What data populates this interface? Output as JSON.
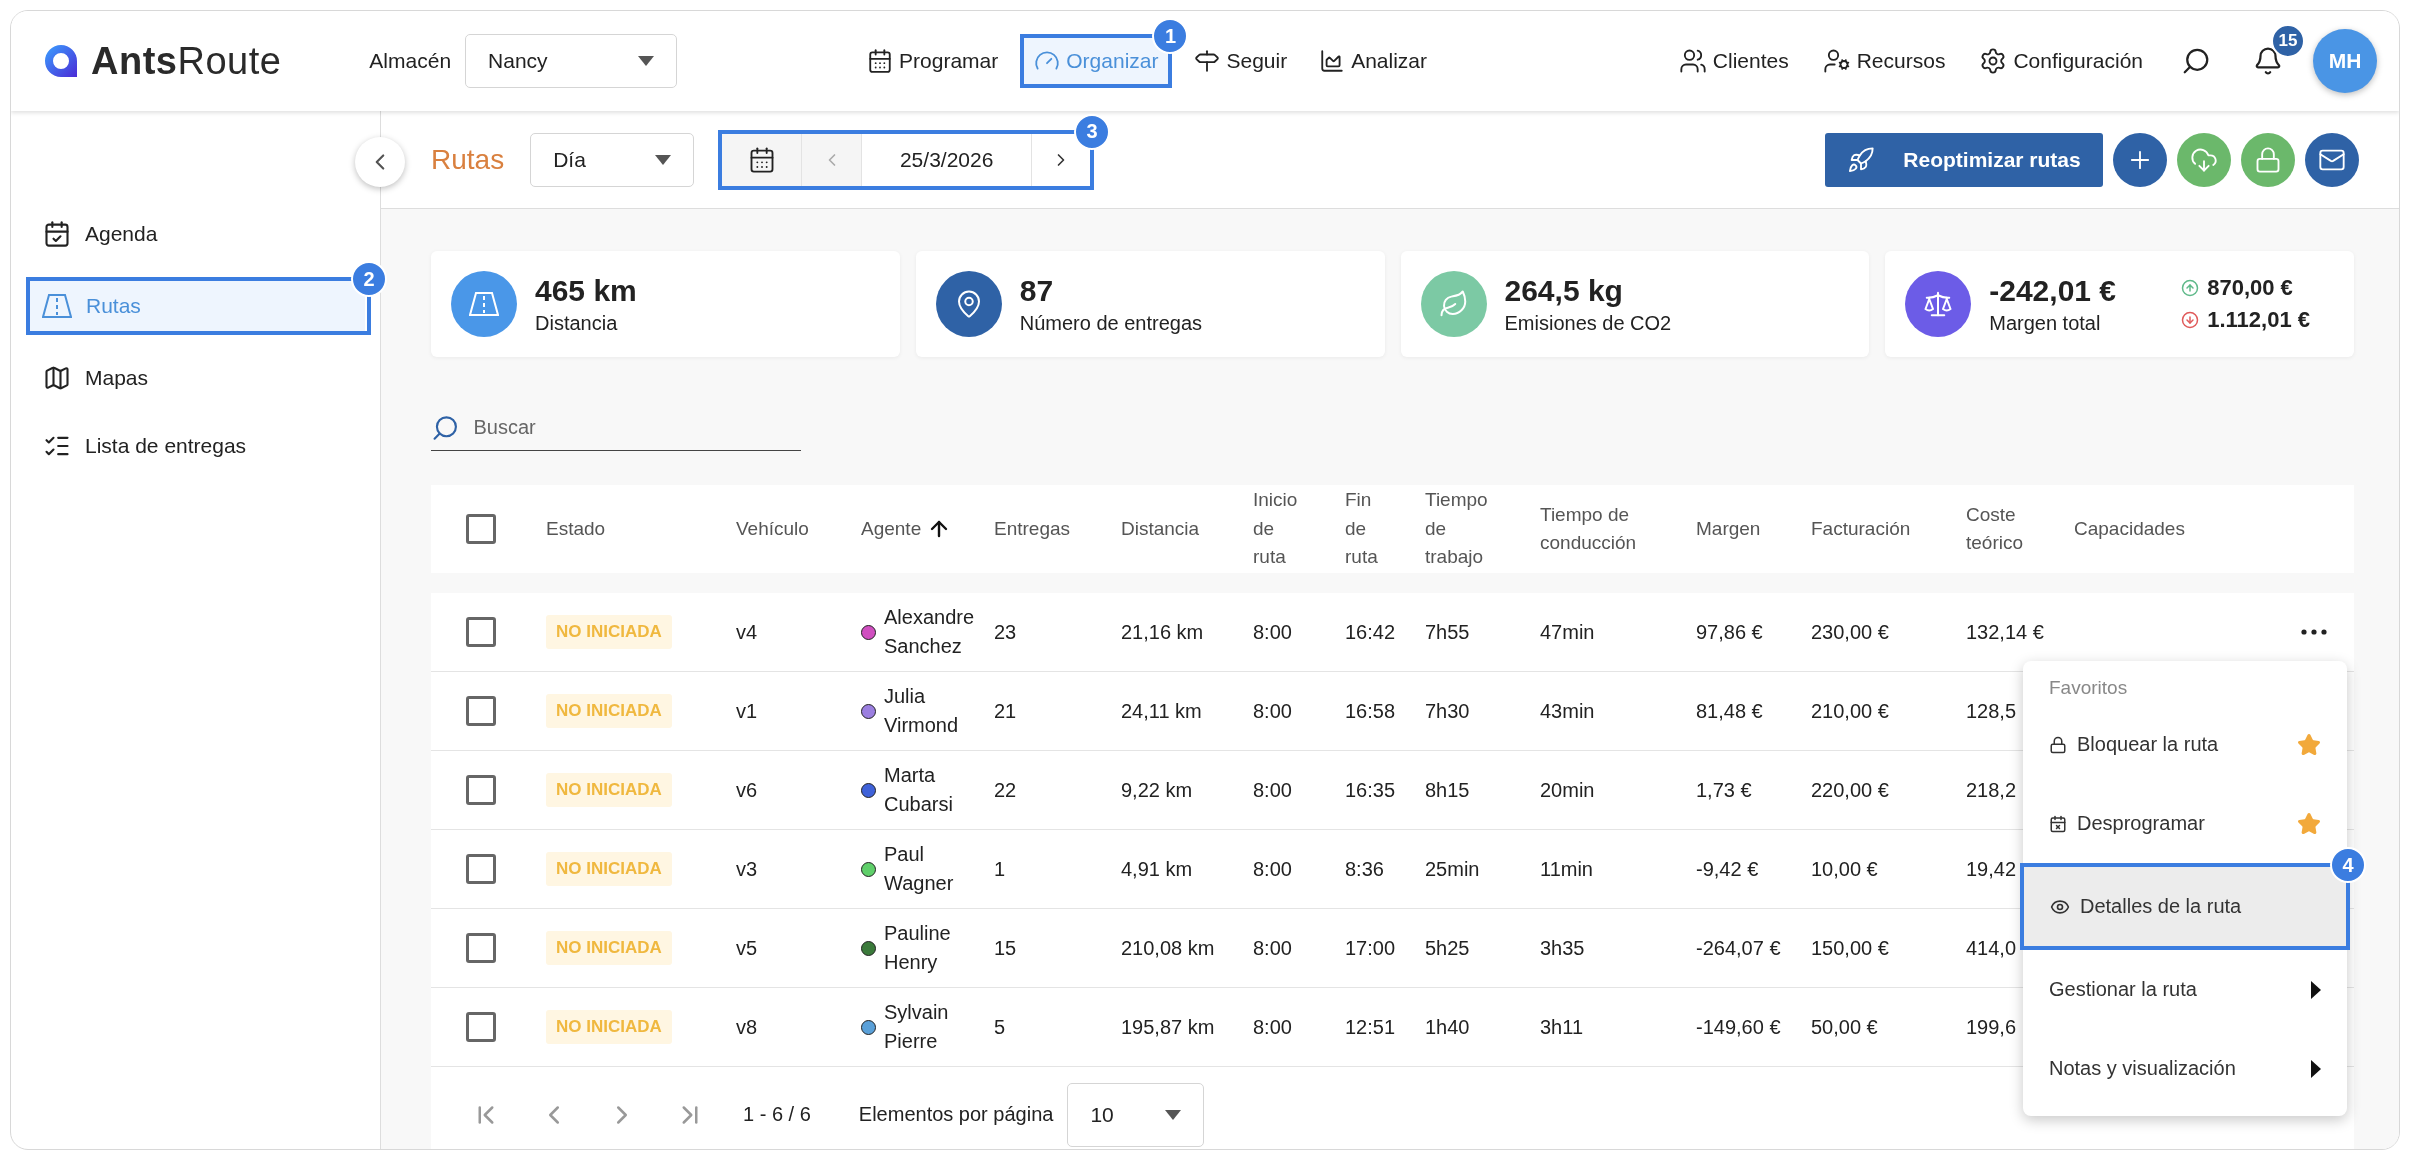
{
  "logo": {
    "text": "**Ants**Route"
  },
  "warehouse": {
    "label": "Almacén",
    "value": "Nancy"
  },
  "nav": [
    {
      "label": "Programar",
      "selected": false
    },
    {
      "label": "Organizar",
      "selected": true,
      "callout": "1"
    },
    {
      "label": "Seguir",
      "selected": false
    },
    {
      "label": "Analizar",
      "selected": false
    }
  ],
  "right_nav": [
    {
      "label": "Clientes"
    },
    {
      "label": "Recursos"
    },
    {
      "label": "Configuración"
    }
  ],
  "notifications": {
    "count": "15"
  },
  "avatar": {
    "initials": "MH"
  },
  "sidebar": {
    "items": [
      {
        "label": "Agenda",
        "selected": false
      },
      {
        "label": "Rutas",
        "selected": true,
        "callout": "2"
      },
      {
        "label": "Mapas",
        "selected": false
      },
      {
        "label": "Lista de entregas",
        "selected": false
      }
    ]
  },
  "toolbar": {
    "title": "Rutas",
    "period": "Día",
    "date": "25/3/2026",
    "date_callout": "3",
    "primary_button": "Reoptimizar rutas",
    "round_buttons": [
      {
        "color": "#2f62a6"
      },
      {
        "color": "#6bb86b"
      },
      {
        "color": "#6bb86b"
      },
      {
        "color": "#2f62a6"
      }
    ]
  },
  "stats": [
    {
      "value": "465 km",
      "label": "Distancia",
      "color": "#4a97e8"
    },
    {
      "value": "87",
      "label": "Número de entregas",
      "color": "#2f62a6"
    },
    {
      "value": "264,5 kg",
      "label": "Emisiones de CO2",
      "color": "#7cc9a4"
    },
    {
      "value": "-242,01 €",
      "label": "Margen total",
      "color": "#6c5ce7",
      "up": "870,00 €",
      "down": "1.112,01 €"
    }
  ],
  "search": {
    "placeholder": "Buscar"
  },
  "table": {
    "select_all": false,
    "columns": [
      "Estado",
      "Vehículo",
      "Agente",
      "Entregas",
      "Distancia",
      "Inicio de ruta",
      "Fin de ruta",
      "Tiempo de trabajo",
      "Tiempo de conducción",
      "Margen",
      "Facturación",
      "Coste teórico",
      "Capacidades"
    ],
    "rows": [
      {
        "checked": false,
        "status": "NO INICIADA",
        "vehicle": "v4",
        "agent": "Alexandre Sanchez",
        "color": "#d04fc0",
        "deliveries": "23",
        "distance": "21,16 km",
        "start": "8:00",
        "end": "16:42",
        "work": "7h55",
        "driving": "47min",
        "margin": "97,86 €",
        "billing": "230,00 €",
        "cost": "132,14 €"
      },
      {
        "checked": false,
        "status": "NO INICIADA",
        "vehicle": "v1",
        "agent": "Julia Virmond",
        "color": "#9b7fe0",
        "deliveries": "21",
        "distance": "24,11 km",
        "start": "8:00",
        "end": "16:58",
        "work": "7h30",
        "driving": "43min",
        "margin": "81,48 €",
        "billing": "210,00 €",
        "cost": "128,5"
      },
      {
        "checked": false,
        "status": "NO INICIADA",
        "vehicle": "v6",
        "agent": "Marta Cubarsi",
        "color": "#3f62d9",
        "deliveries": "22",
        "distance": "9,22 km",
        "start": "8:00",
        "end": "16:35",
        "work": "8h15",
        "driving": "20min",
        "margin": "1,73 €",
        "billing": "220,00 €",
        "cost": "218,2"
      },
      {
        "checked": false,
        "status": "NO INICIADA",
        "vehicle": "v3",
        "agent": "Paul Wagner",
        "color": "#5fcf6a",
        "deliveries": "1",
        "distance": "4,91 km",
        "start": "8:00",
        "end": "8:36",
        "work": "25min",
        "driving": "11min",
        "margin": "-9,42 €",
        "billing": "10,00 €",
        "cost": "19,42"
      },
      {
        "checked": false,
        "status": "NO INICIADA",
        "vehicle": "v5",
        "agent": "Pauline Henry",
        "color": "#3b7a3b",
        "deliveries": "15",
        "distance": "210,08 km",
        "start": "8:00",
        "end": "17:00",
        "work": "5h25",
        "driving": "3h35",
        "margin": "-264,07 €",
        "billing": "150,00 €",
        "cost": "414,0"
      },
      {
        "checked": false,
        "status": "NO INICIADA",
        "vehicle": "v8",
        "agent": "Sylvain Pierre",
        "color": "#5aa0d8",
        "deliveries": "5",
        "distance": "195,87 km",
        "start": "8:00",
        "end": "12:51",
        "work": "1h40",
        "driving": "3h11",
        "margin": "-149,60 €",
        "billing": "50,00 €",
        "cost": "199,6"
      }
    ]
  },
  "pagination": {
    "range": "1 - 6 / 6",
    "per_page_label": "Elementos por página",
    "per_page": "10"
  },
  "context_menu": {
    "items": [
      {
        "kind": "label",
        "label": "Favoritos"
      },
      {
        "kind": "action",
        "label": "Bloquear la ruta",
        "favorite": true,
        "selected": false
      },
      {
        "kind": "action",
        "label": "Desprogramar",
        "favorite": true,
        "selected": false
      },
      {
        "kind": "action",
        "label": "Detalles de la ruta",
        "favorite": false,
        "selected": true,
        "callout": "4"
      },
      {
        "kind": "submenu",
        "label": "Gestionar la ruta"
      },
      {
        "kind": "submenu",
        "label": "Notas y visualización"
      }
    ]
  }
}
